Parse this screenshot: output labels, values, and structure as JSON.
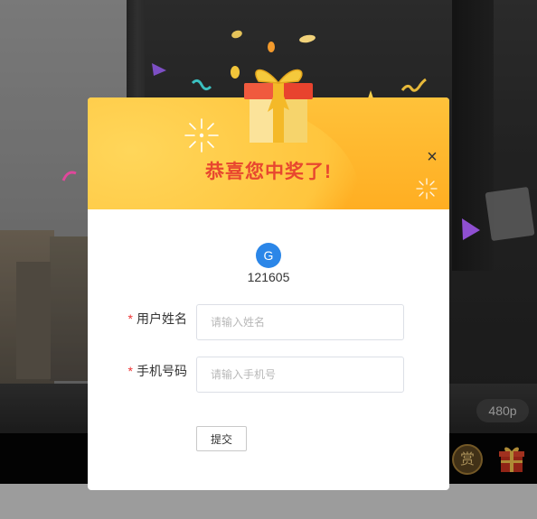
{
  "player": {
    "quality": "480p",
    "reward_label": "赏"
  },
  "dialog": {
    "title": "恭喜您中奖了!",
    "close_glyph": "×",
    "avatar_letter": "G",
    "user_id": "121605",
    "fields": {
      "name": {
        "required_mark": "*",
        "label": "用户姓名",
        "placeholder": "请输入姓名",
        "value": ""
      },
      "phone": {
        "required_mark": "*",
        "label": "手机号码",
        "placeholder": "请输入手机号",
        "value": ""
      }
    },
    "submit_label": "提交"
  },
  "colors": {
    "header_gradient_top": "#ffc23a",
    "header_gradient_bottom": "#ffae22",
    "title_color": "#e8472f",
    "avatar_bg": "#2b86e8",
    "required_color": "#e33333"
  },
  "icons": {
    "close": "close-icon",
    "gift": "gift-box-icon",
    "sparkle": "sparkle-icon",
    "reward": "reward-icon",
    "player_gift": "gift-icon"
  }
}
